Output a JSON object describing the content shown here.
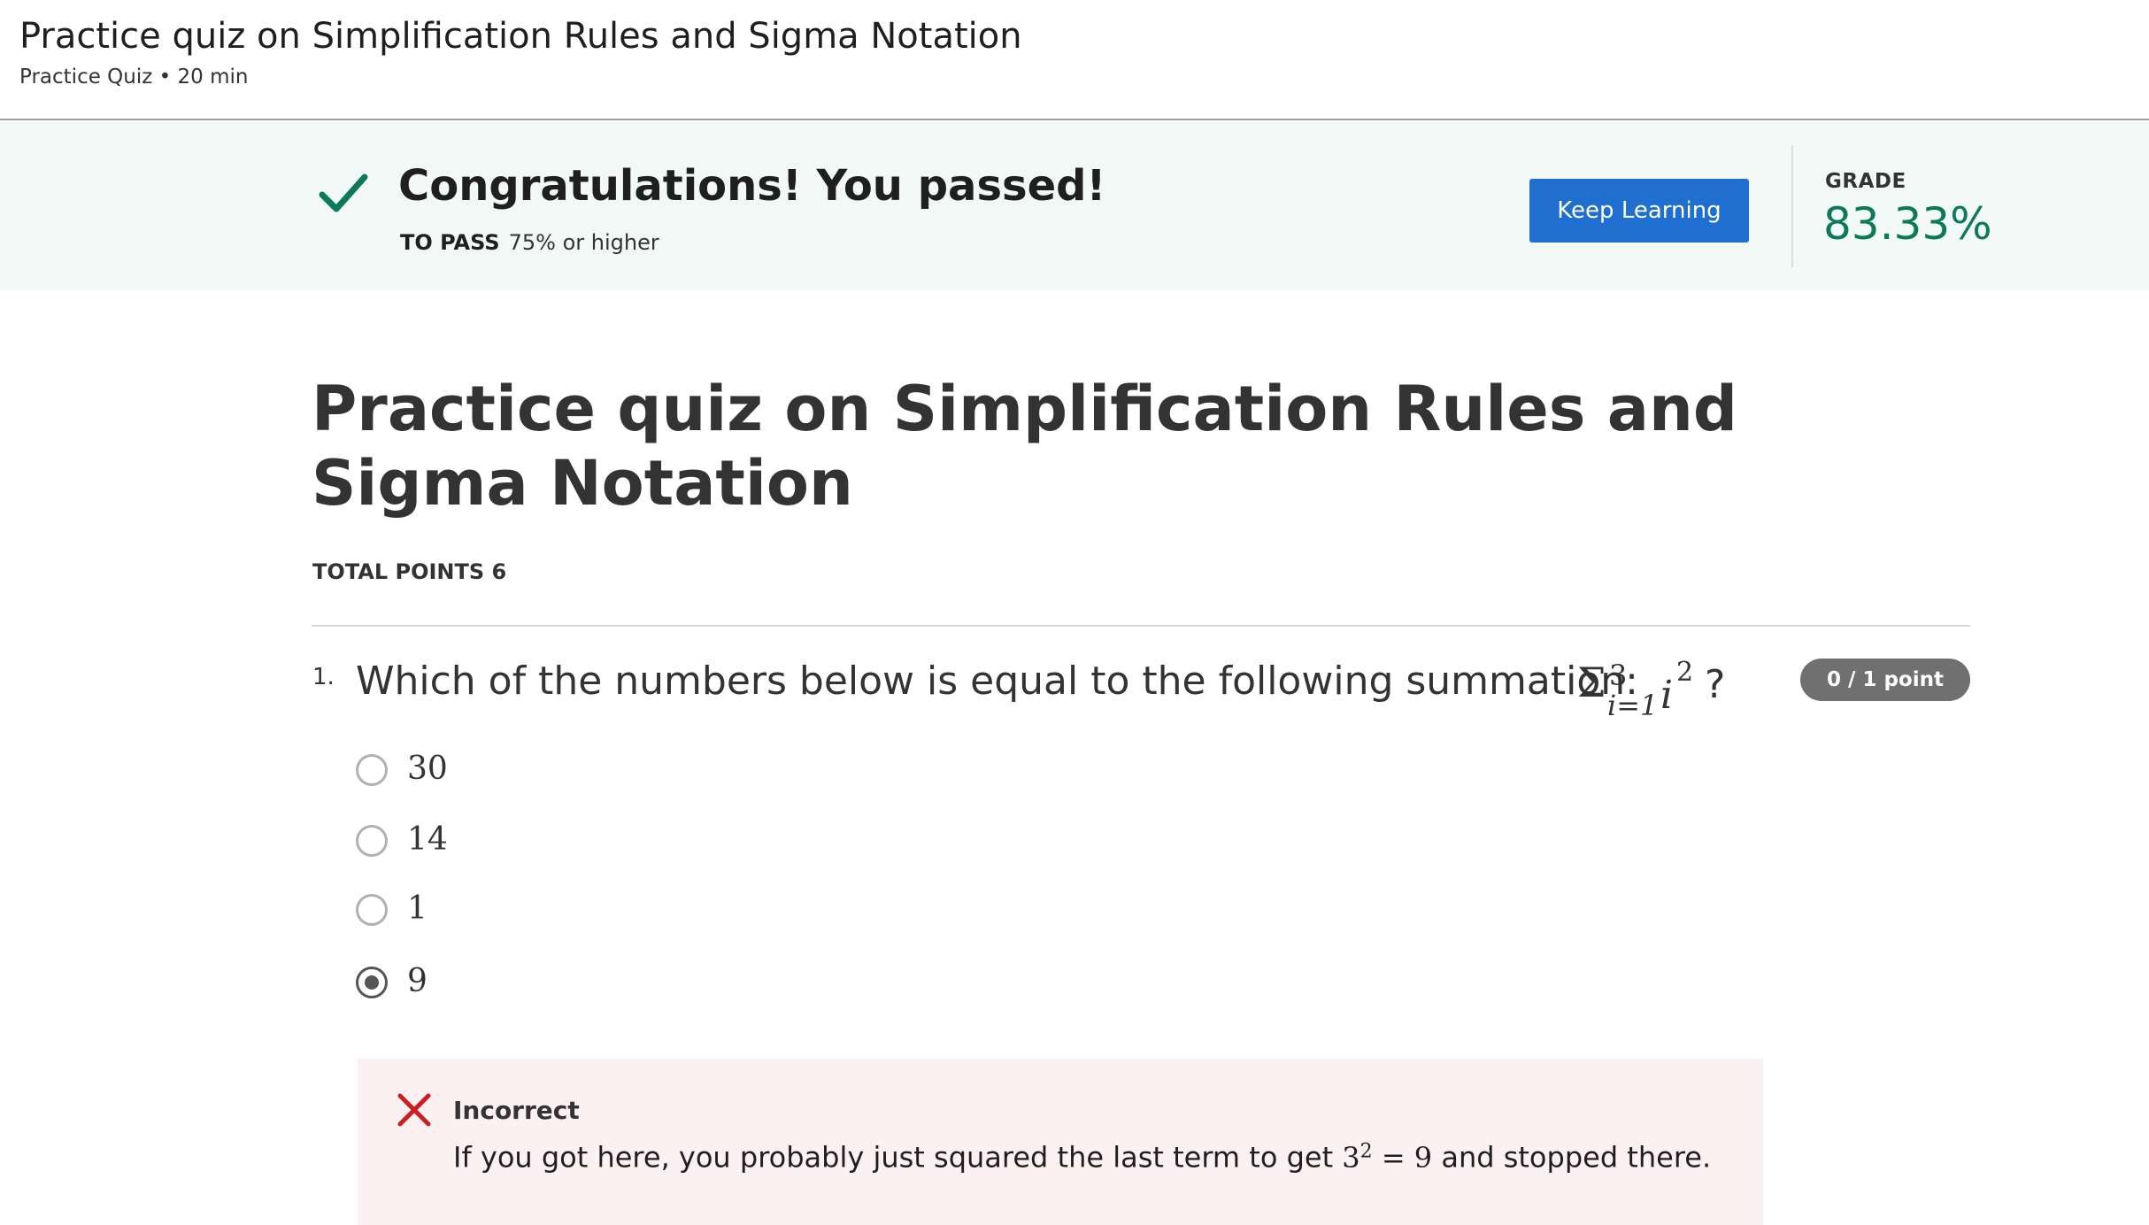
{
  "header": {
    "title": "Practice quiz on Simplification Rules and Sigma Notation",
    "subtitle": "Practice Quiz • 20 min"
  },
  "banner": {
    "message": "Congratulations! You passed!",
    "to_pass_label": "TO PASS",
    "to_pass_value": "75% or higher",
    "keep_learning_label": "Keep Learning",
    "grade_label": "GRADE",
    "grade_value": "83.33%",
    "colors": {
      "background": "#f2f8f6",
      "check": "#0c7a5a",
      "button": "#1f6fd1",
      "grade": "#0c7a5a"
    }
  },
  "quiz": {
    "title": "Practice quiz on Simplification Rules and Sigma Notation",
    "total_points": "TOTAL POINTS 6"
  },
  "question1": {
    "number": "1.",
    "text": "Which of the numbers below is equal to the following summation:",
    "math": {
      "sigma": "Σ",
      "upper": "3",
      "lower": "i=1",
      "term": "i",
      "exponent": "2"
    },
    "qmark": "?",
    "points": "0 / 1 point",
    "options": [
      {
        "label": "30",
        "selected": false
      },
      {
        "label": "14",
        "selected": false
      },
      {
        "label": "1",
        "selected": false
      },
      {
        "label": "9",
        "selected": true
      }
    ],
    "feedback": {
      "status": "Incorrect",
      "text_before": "If you got here, you probably just squared the last term to get",
      "math_base": "3",
      "math_exp": "2",
      "math_rest": "= 9",
      "text_after": "and stopped there.",
      "color": "#cc1f1f"
    }
  }
}
